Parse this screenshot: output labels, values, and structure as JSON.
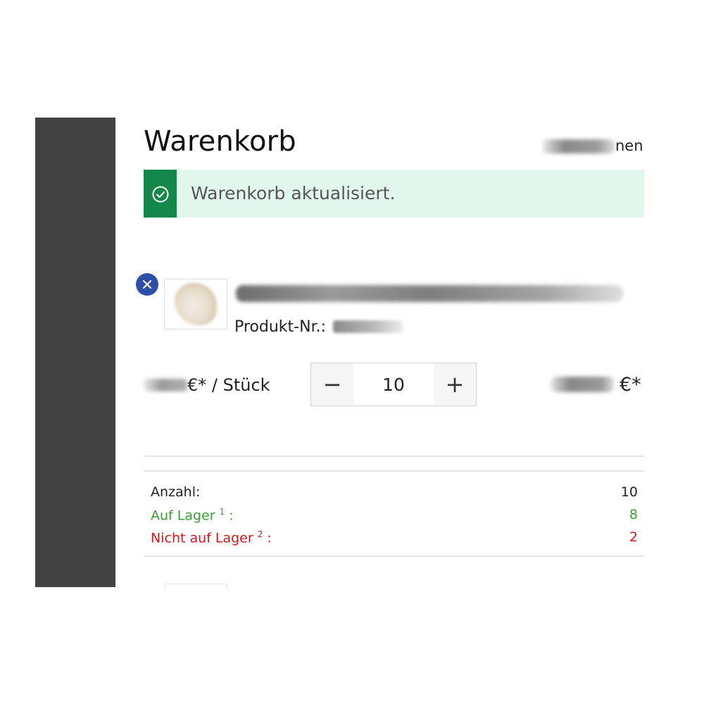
{
  "cart": {
    "title": "Warenkorb",
    "close_label_visible": "nen"
  },
  "alert": {
    "icon": "check-circle-icon",
    "message": "Warenkorb aktualisiert.",
    "accent_color": "#14874a",
    "background_color": "#e2f7ec"
  },
  "line_item": {
    "remove_icon": "close-icon",
    "product_number_label": "Produkt-Nr.:",
    "unit_price_suffix": "€* / Stück",
    "quantity": "10",
    "decrement_symbol": "−",
    "increment_symbol": "+",
    "total_price_suffix": "€*"
  },
  "summary": {
    "quantity_label": "Anzahl:",
    "quantity_value": "10",
    "in_stock_label": "Auf Lager",
    "in_stock_footnote": "1",
    "in_stock_colon": " :",
    "in_stock_value": "8",
    "in_stock_color": "#3aa130",
    "out_of_stock_label": "Nicht auf Lager",
    "out_of_stock_footnote": "2",
    "out_of_stock_colon": " :",
    "out_of_stock_value": "2",
    "out_of_stock_color": "#d8141c"
  }
}
